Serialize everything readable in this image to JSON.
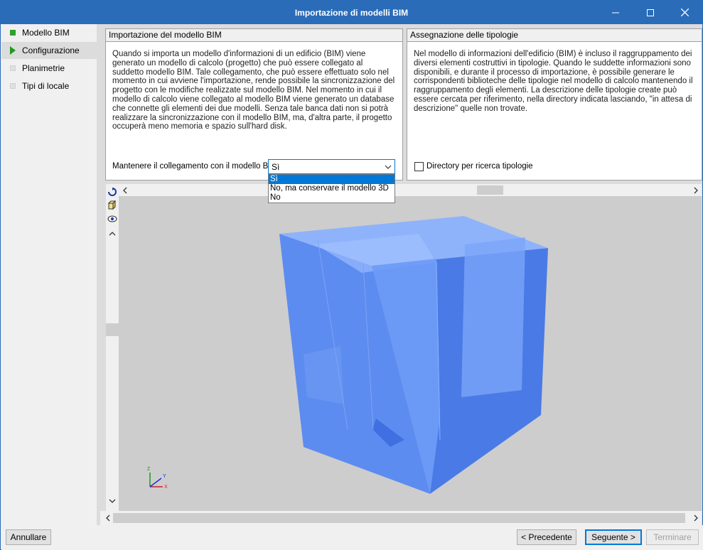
{
  "window": {
    "title": "Importazione di modelli BIM"
  },
  "sidebar": {
    "items": [
      {
        "label": "Modello BIM",
        "icon": "green-square-icon"
      },
      {
        "label": "Configurazione",
        "icon": "green-arrow-icon"
      },
      {
        "label": "Planimetrie",
        "icon": "grey-square-icon"
      },
      {
        "label": "Tipi di locale",
        "icon": "grey-square-icon"
      }
    ]
  },
  "import_panel": {
    "title": "Importazione del modello BIM",
    "text": "Quando si importa un modello d'informazioni di un edificio (BIM) viene generato un modello di calcolo (progetto) che può essere collegato al suddetto modello BIM. Tale collegamento, che può essere effettuato solo nel momento in cui avviene l'importazione, rende possibile la sincronizzazione del progetto con le modifiche realizzate sul modello BIM. Nel momento in cui il modello di calcolo viene collegato al modello BIM viene generato un database che connette gli elementi dei due modelli. Senza tale banca dati non si potrà realizzare la sincronizzazione con il modello BIM, ma, d'altra parte, il progetto occuperà meno memoria e spazio sull'hard disk.",
    "link_label": "Mantenere il collegamento con il modello BIM",
    "link_value": "Sì",
    "options": [
      "Sì",
      "No, ma conservare il modello 3D",
      "No"
    ]
  },
  "types_panel": {
    "title": "Assegnazione delle tipologie",
    "text": "Nel modello di informazioni dell'edificio (BIM) è incluso il raggruppamento dei diversi elementi costruttivi in tipologie. Quando le suddette informazioni sono disponibili, e durante il processo di importazione, è possibile generare le corrispondenti biblioteche delle tipologie nel modello di calcolo mantenendo il raggruppamento degli elementi. La descrizione delle tipologie create può essere cercata per riferimento, nella directory indicata lasciando, \"in attesa di descrizione\" quelle non trovate.",
    "checkbox_label": "Directory per ricerca tipologie",
    "checkbox_checked": false
  },
  "axes": {
    "z": "Z",
    "y": "Y",
    "x": "X"
  },
  "buttons": {
    "cancel": "Annullare",
    "previous": "< Precedente",
    "next": "Seguente >",
    "finish": "Terminare"
  },
  "colors": {
    "titlebar": "#2b6cb8",
    "accent": "#0078d7",
    "model": "#5a8ff0"
  }
}
